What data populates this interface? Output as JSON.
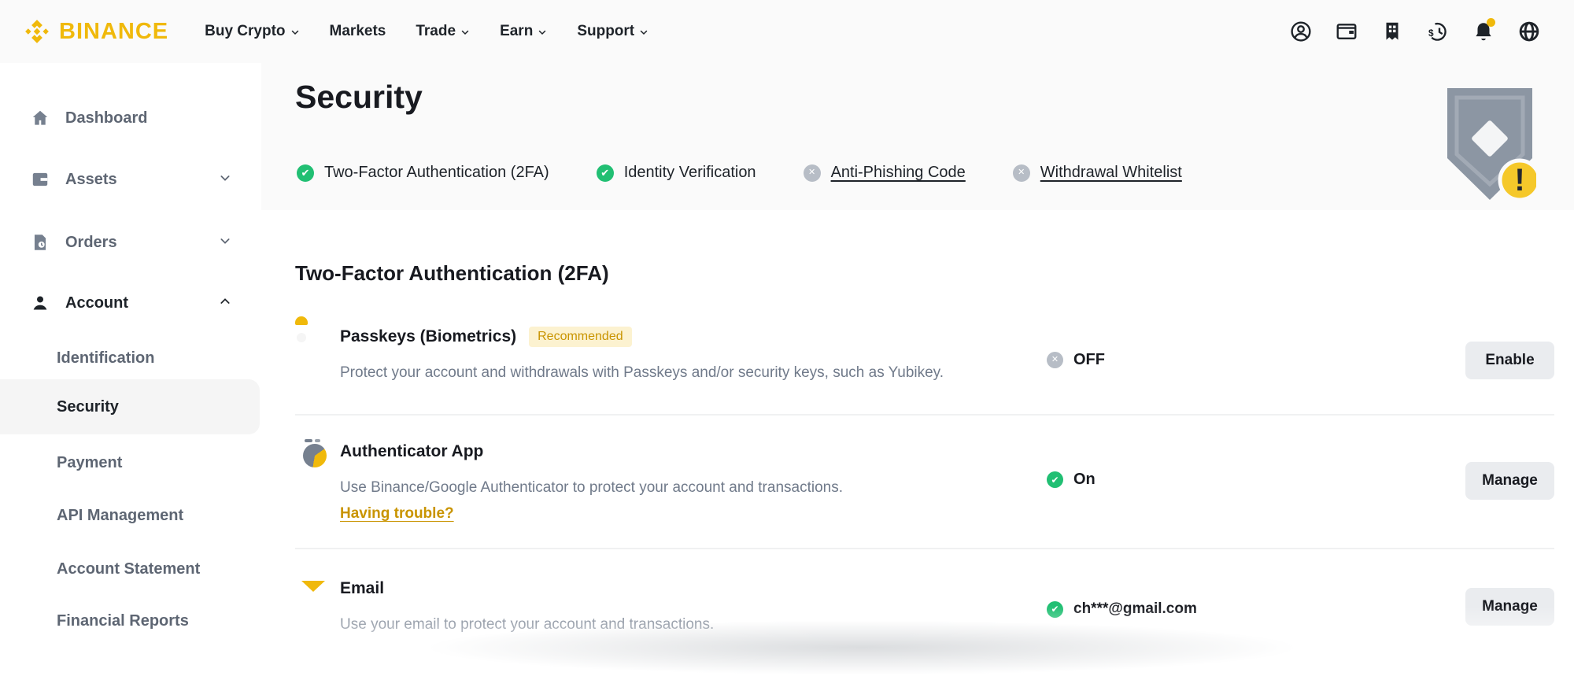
{
  "colors": {
    "brand_yellow": "#F0B90B",
    "success_green": "#21BF73",
    "inactive_gray": "#B7BDC6",
    "link_gold": "#C99400",
    "band_background": "#FAFAFA"
  },
  "navbar": {
    "brand": "BINANCE",
    "links": [
      {
        "label": "Buy Crypto",
        "chevron": true
      },
      {
        "label": "Markets",
        "chevron": false
      },
      {
        "label": "Trade",
        "chevron": true
      },
      {
        "label": "Earn",
        "chevron": true
      },
      {
        "label": "Support",
        "chevron": true
      }
    ],
    "icons": [
      "profile",
      "wallet",
      "building",
      "order-history",
      "notifications",
      "language"
    ],
    "notification_dot": true
  },
  "sidebar": {
    "items": [
      {
        "label": "Dashboard",
        "icon": "home"
      },
      {
        "label": "Assets",
        "icon": "wallet",
        "chevron": "down"
      },
      {
        "label": "Orders",
        "icon": "orders",
        "chevron": "down"
      },
      {
        "label": "Account",
        "icon": "person",
        "chevron": "up",
        "expanded": true
      }
    ],
    "account_subitems": [
      "Identification",
      "Security",
      "Payment",
      "API Management",
      "Account Statement",
      "Financial Reports"
    ],
    "active_item": "Security"
  },
  "header": {
    "title": "Security",
    "checks": [
      {
        "label": "Two-Factor Authentication (2FA)",
        "state": "done"
      },
      {
        "label": "Identity Verification",
        "state": "done"
      },
      {
        "label": "Anti-Phishing Code",
        "state": "not-set"
      },
      {
        "label": "Withdrawal Whitelist",
        "state": "not-set"
      }
    ],
    "shield_badge": "warning"
  },
  "twofa": {
    "heading": "Two-Factor Authentication (2FA)",
    "rows": [
      {
        "title": "Passkeys (Biometrics)",
        "badge": "Recommended",
        "description": "Protect your account and withdrawals with Passkeys and/or security keys, such as Yubikey.",
        "status_text": "OFF",
        "status_state": "off",
        "action": "Enable"
      },
      {
        "title": "Authenticator App",
        "description": "Use Binance/Google Authenticator to protect your account and transactions.",
        "link": "Having trouble?",
        "status_text": "On",
        "status_state": "on",
        "action": "Manage"
      },
      {
        "title": "Email",
        "description": "Use your email to protect your account and transactions.",
        "status_text": "ch***@gmail.com",
        "status_state": "on",
        "action": "Manage"
      }
    ]
  }
}
